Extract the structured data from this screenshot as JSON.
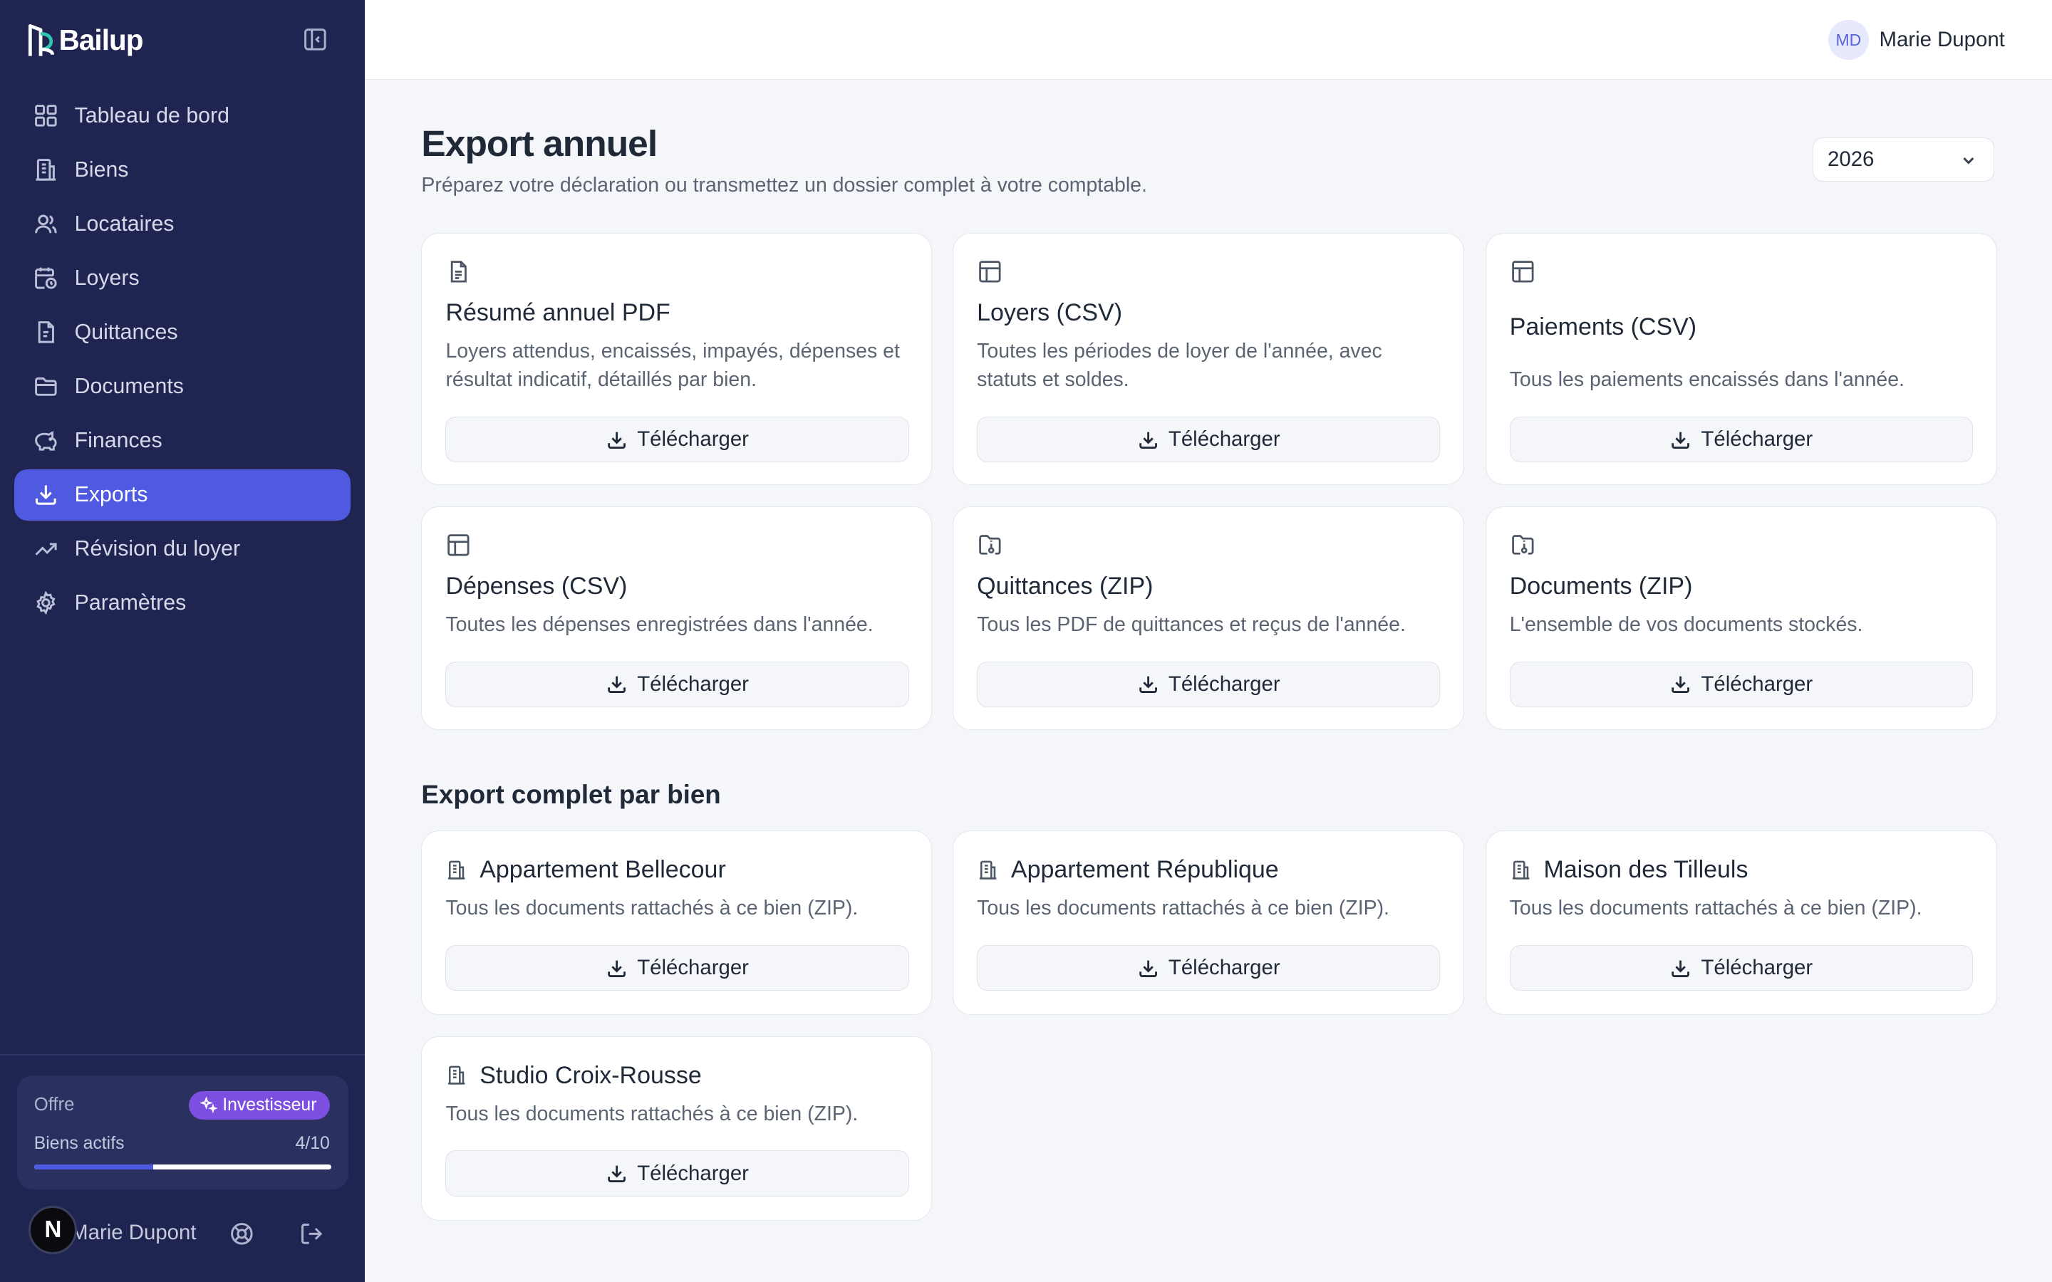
{
  "brand": {
    "name": "Bailup"
  },
  "sidebar": {
    "items": [
      {
        "label": "Tableau de bord",
        "icon": "dashboard-icon"
      },
      {
        "label": "Biens",
        "icon": "building-icon"
      },
      {
        "label": "Locataires",
        "icon": "users-icon"
      },
      {
        "label": "Loyers",
        "icon": "calendar-clock-icon"
      },
      {
        "label": "Quittances",
        "icon": "receipt-icon"
      },
      {
        "label": "Documents",
        "icon": "folder-icon"
      },
      {
        "label": "Finances",
        "icon": "piggy-bank-icon"
      },
      {
        "label": "Exports",
        "icon": "download-icon",
        "active": true
      },
      {
        "label": "Révision du loyer",
        "icon": "trending-up-icon"
      },
      {
        "label": "Paramètres",
        "icon": "settings-icon"
      }
    ],
    "plan": {
      "label": "Offre",
      "badge": "Investisseur",
      "usage_label": "Biens actifs",
      "usage_text": "4/10",
      "usage_fraction": 0.4
    },
    "user": {
      "initial": "N",
      "name": "Marie Dupont"
    }
  },
  "topbar": {
    "initials": "MD",
    "name": "Marie Dupont"
  },
  "page": {
    "title": "Export annuel",
    "subtitle": "Préparez votre déclaration ou transmettez un dossier complet à votre comptable.",
    "year": "2026"
  },
  "download_label": "Télécharger",
  "exports": [
    {
      "title": "Résumé annuel PDF",
      "description": "Loyers attendus, encaissés, impayés, dépenses et résultat indicatif, détaillés par bien.",
      "icon": "file-text-icon"
    },
    {
      "title": "Loyers (CSV)",
      "description": "Toutes les périodes de loyer de l'année, avec statuts et soldes.",
      "icon": "table-icon"
    },
    {
      "title": "Paiements (CSV)",
      "description": "Tous les paiements encaissés dans l'année.",
      "icon": "table-icon"
    },
    {
      "title": "Dépenses (CSV)",
      "description": "Toutes les dépenses enregistrées dans l'année.",
      "icon": "table-icon"
    },
    {
      "title": "Quittances (ZIP)",
      "description": "Tous les PDF de quittances et reçus de l'année.",
      "icon": "folder-archive-icon"
    },
    {
      "title": "Documents (ZIP)",
      "description": "L'ensemble de vos documents stockés.",
      "icon": "folder-archive-icon"
    }
  ],
  "by_property": {
    "title": "Export complet par bien",
    "items": [
      {
        "name": "Appartement Bellecour",
        "description": "Tous les documents rattachés à ce bien (ZIP)."
      },
      {
        "name": "Appartement République",
        "description": "Tous les documents rattachés à ce bien (ZIP)."
      },
      {
        "name": "Maison des Tilleuls",
        "description": "Tous les documents rattachés à ce bien (ZIP)."
      },
      {
        "name": "Studio Croix-Rousse",
        "description": "Tous les documents rattachés à ce bien (ZIP)."
      }
    ]
  },
  "colors": {
    "sidebar": "#1f2550",
    "accent": "#4f5ae0",
    "badge": "#7c4fe0",
    "background": "#f4f6f9"
  }
}
